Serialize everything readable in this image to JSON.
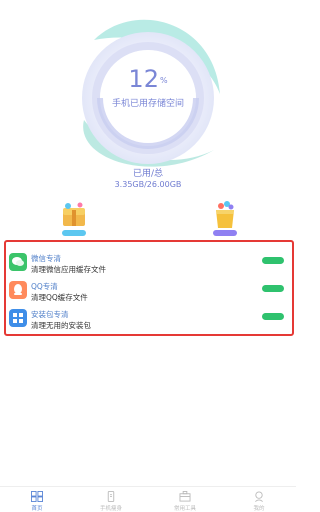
{
  "storage": {
    "percent": "12",
    "percent_sign": "%",
    "label": "手机已用存储空间",
    "used_title": "已用/总",
    "used_value": "3.35GB/26.00GB",
    "fill_fraction": 0.12
  },
  "features": [
    {
      "icon": "treasure-box-icon"
    },
    {
      "icon": "gift-bag-icon"
    }
  ],
  "clean_items": [
    {
      "title": "微信专清",
      "desc": "清理微信应用缓存文件",
      "icon": "wechat-icon",
      "color": "#3bc46a"
    },
    {
      "title": "QQ专清",
      "desc": "清理QQ缓存文件",
      "icon": "qq-icon",
      "color": "#ff8a5c"
    },
    {
      "title": "安装包专清",
      "desc": "清理无用的安装包",
      "icon": "apk-grid-icon",
      "color": "#3f8ee8"
    }
  ],
  "tabs": [
    {
      "label": "首页",
      "icon": "home-grid-icon",
      "active": true
    },
    {
      "label": "手机瘦身",
      "icon": "phone-slim-icon",
      "active": false
    },
    {
      "label": "常用工具",
      "icon": "toolbox-icon",
      "active": false
    },
    {
      "label": "我的",
      "icon": "profile-icon",
      "active": false
    }
  ],
  "colors": {
    "accent": "#7a86d6",
    "highlight_border": "#e53935",
    "button_green": "#2fc26e",
    "tab_active": "#5b86d6"
  }
}
